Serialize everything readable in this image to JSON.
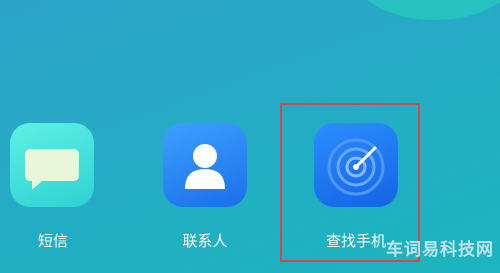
{
  "apps": [
    {
      "id": "sms",
      "label": "短信",
      "icon": "message-bubble-icon"
    },
    {
      "id": "contacts",
      "label": "联系人",
      "icon": "person-icon"
    },
    {
      "id": "find_phone",
      "label": "查找手机",
      "icon": "radar-icon"
    }
  ],
  "watermark": "车词易科技网",
  "colors": {
    "background": "#27a9c6",
    "highlight": "#d0484a",
    "sms": "#3ad9d8",
    "contacts": "#2481f0",
    "find_phone": "#1d75f2"
  }
}
